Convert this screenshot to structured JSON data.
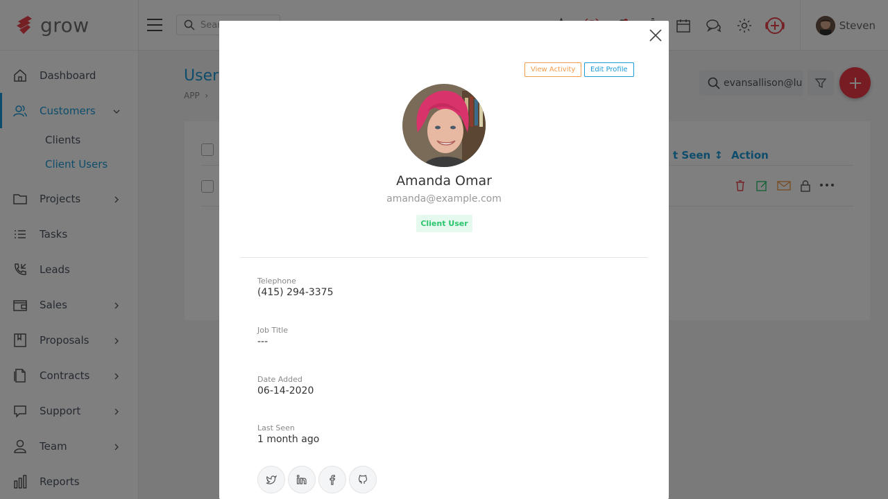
{
  "app": {
    "logo_text": "grow"
  },
  "sidebar": {
    "items": [
      {
        "label": "Dashboard"
      },
      {
        "label": "Customers"
      },
      {
        "label": "Projects"
      },
      {
        "label": "Tasks"
      },
      {
        "label": "Leads"
      },
      {
        "label": "Sales"
      },
      {
        "label": "Proposals"
      },
      {
        "label": "Contracts"
      },
      {
        "label": "Support"
      },
      {
        "label": "Team"
      },
      {
        "label": "Reports"
      }
    ],
    "sub_items": [
      {
        "label": "Clients"
      },
      {
        "label": "Client Users"
      }
    ]
  },
  "topbar": {
    "search_placeholder": "Search",
    "user_name": "Steven"
  },
  "page": {
    "title": "Users",
    "breadcrumb": "APP",
    "search_value": "evansallison@lu",
    "columns": {
      "last_seen": "t Seen ↕",
      "action": "Action"
    }
  },
  "modal": {
    "view_activity_label": "View Activity",
    "edit_profile_label": "Edit Profile",
    "name": "Amanda Omar",
    "email": "amanda@example.com",
    "badge": "Client User",
    "fields": [
      {
        "label": "Telephone",
        "value": "(415) 294-3375"
      },
      {
        "label": "Job Title",
        "value": "---"
      },
      {
        "label": "Date Added",
        "value": "06-14-2020"
      },
      {
        "label": "Last Seen",
        "value": "1 month ago"
      }
    ]
  },
  "colors": {
    "accent": "#1a9ad6",
    "brand_red": "#ee3844",
    "badge_green": "#2bc56d",
    "activity_orange": "#f19c4b"
  }
}
